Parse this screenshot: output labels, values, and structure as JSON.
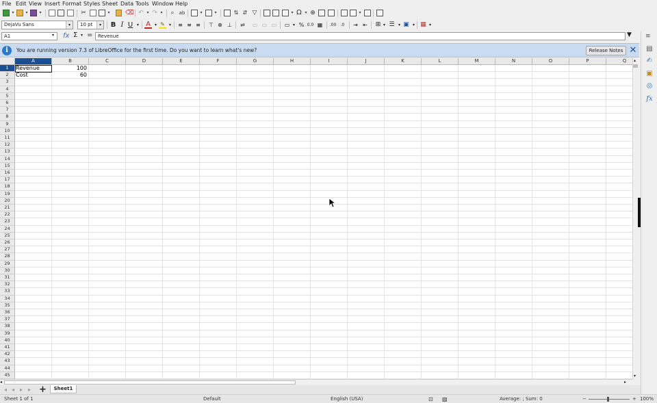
{
  "menu": [
    "File",
    "Edit",
    "View",
    "Insert",
    "Format",
    "Styles",
    "Sheet",
    "Data",
    "Tools",
    "Window",
    "Help"
  ],
  "toolbar": {
    "font_name": "DejaVu Sans",
    "font_size": "10 pt",
    "bold": "B",
    "italic": "I",
    "underline": "U",
    "font_color": "A",
    "percent": "%",
    "decimals": "0.0"
  },
  "formula_bar": {
    "cell_ref": "A1",
    "fx_label": "fx",
    "sum_label": "Σ",
    "equals_label": "=",
    "content": "Revenue"
  },
  "infobar": {
    "message": "You are running version 7.3 of LibreOffice for the first time. Do you want to learn what's new?",
    "button": "Release Notes",
    "info_glyph": "i",
    "close_glyph": "✕"
  },
  "grid": {
    "columns": [
      "A",
      "B",
      "C",
      "D",
      "E",
      "F",
      "G",
      "H",
      "I",
      "J",
      "K",
      "L",
      "M",
      "N",
      "O",
      "P",
      "Q"
    ],
    "rows": [
      "1",
      "2",
      "3",
      "4",
      "5",
      "6",
      "7",
      "8",
      "9",
      "10",
      "11",
      "12",
      "13",
      "14",
      "15",
      "16",
      "17",
      "18",
      "19",
      "20",
      "21",
      "22",
      "23",
      "24",
      "25",
      "26",
      "27",
      "28",
      "29",
      "30",
      "31",
      "32",
      "33",
      "34",
      "35",
      "36",
      "37",
      "38",
      "39",
      "40",
      "41",
      "42",
      "43",
      "44",
      "45"
    ],
    "cells": {
      "A1": "Revenue",
      "B1": "100",
      "A2": "Cost",
      "B2": "60"
    },
    "selected_cell": "A1"
  },
  "tabs": {
    "add_glyph": "+",
    "sheets": [
      "Sheet1"
    ]
  },
  "status": {
    "sheet_info": "Sheet 1 of 1",
    "page_style": "Default",
    "language": "English (USA)",
    "summary": "Average: ; Sum: 0",
    "zoom_minus": "−",
    "zoom_plus": "+",
    "zoom": "100%"
  },
  "colors": {
    "accent": "#1b4f94",
    "infobar": "#c8dbf0"
  }
}
